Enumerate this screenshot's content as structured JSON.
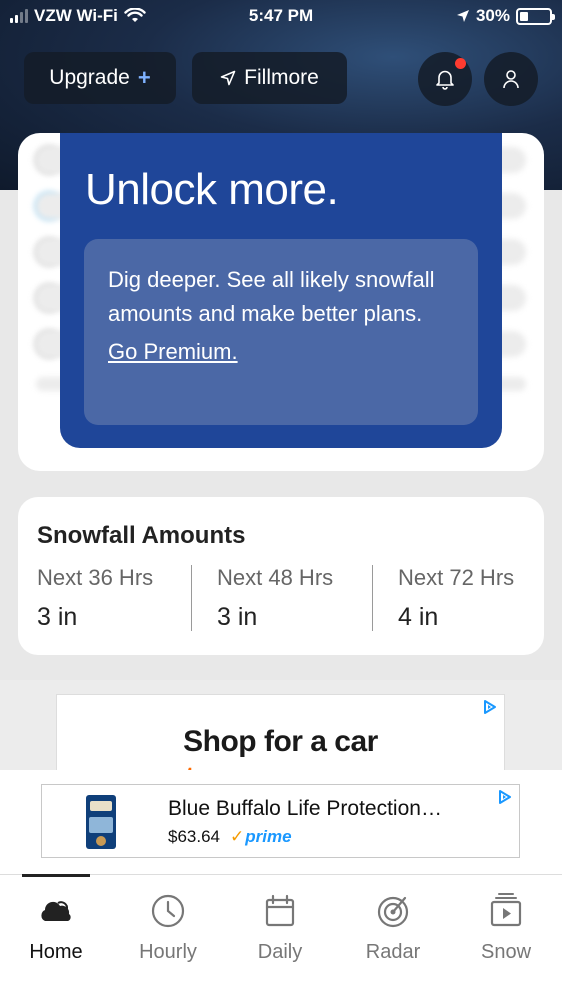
{
  "status_bar": {
    "carrier": "VZW Wi-Fi",
    "time": "5:47 PM",
    "battery_percent": "30%",
    "battery_level": 0.3
  },
  "header": {
    "upgrade_label": "Upgrade",
    "upgrade_plus": "+",
    "location_label": "Fillmore",
    "has_notification": true
  },
  "premium_card": {
    "title": "Unlock more.",
    "body": "Dig deeper. See all likely snowfall amounts and make better plans.",
    "link": "Go Premium."
  },
  "snowfall": {
    "title": "Snowfall Amounts",
    "periods": [
      {
        "label": "Next 36 Hrs",
        "value": "3 in"
      },
      {
        "label": "Next 48 Hrs",
        "value": "3 in"
      },
      {
        "label": "Next 72 Hrs",
        "value": "4 in"
      }
    ]
  },
  "ad_banner": {
    "headline": "Shop for a car",
    "subline": "at your own pace"
  },
  "product_ad": {
    "name": "Blue Buffalo Life Protection…",
    "price": "$63.64",
    "prime_check": "✓",
    "prime_label": "prime"
  },
  "tabs": [
    {
      "label": "Home",
      "icon": "cloud-icon",
      "active": true
    },
    {
      "label": "Hourly",
      "icon": "clock-icon",
      "active": false
    },
    {
      "label": "Daily",
      "icon": "calendar-icon",
      "active": false
    },
    {
      "label": "Radar",
      "icon": "radar-icon",
      "active": false
    },
    {
      "label": "Snow",
      "icon": "snow-video-icon",
      "active": false
    }
  ],
  "colors": {
    "premium_bg": "#1f4699",
    "premium_inner": "#4b68a6",
    "notification_dot": "#ff3b30",
    "prime_blue": "#1a98ff",
    "ad_orange": "#ff6a00"
  }
}
